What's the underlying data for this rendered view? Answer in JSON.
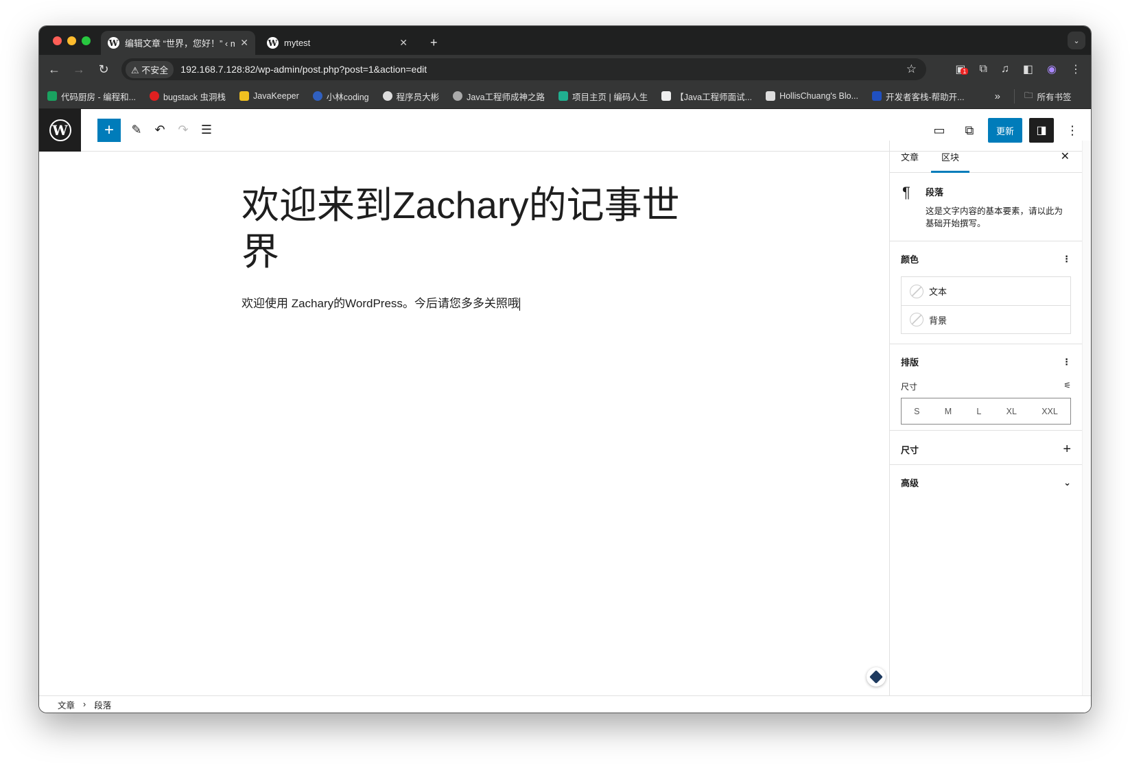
{
  "browser": {
    "tabs": [
      {
        "title": "编辑文章 “世界，您好！” ‹ my",
        "active": true
      },
      {
        "title": "mytest",
        "active": false
      }
    ],
    "new_tab": "+",
    "security": "不安全",
    "url": "192.168.7.128:82/wp-admin/post.php?post=1&action=edit",
    "ext_badge": "1",
    "bookmarks": [
      {
        "label": "代码厨房 - 编程和...",
        "color": "#1aa260"
      },
      {
        "label": "bugstack 虫洞栈",
        "color": "#e02020"
      },
      {
        "label": "JavaKeeper",
        "color": "#f0c020"
      },
      {
        "label": "小林coding",
        "color": "#3060c0"
      },
      {
        "label": "程序员大彬",
        "color": "#ddd"
      },
      {
        "label": "Java工程师成神之路",
        "color": "#aaa"
      },
      {
        "label": "项目主页 | 编码人生",
        "color": "#20b090"
      },
      {
        "label": "【Java工程师面试...",
        "color": "#eee"
      },
      {
        "label": "HollisChuang's Blo...",
        "color": "#ddd"
      },
      {
        "label": "开发者客栈-帮助开...",
        "color": "#2050c0"
      }
    ],
    "more": "»",
    "all_bookmarks": "所有书签"
  },
  "editor": {
    "update_label": "更新",
    "post_title": "欢迎来到Zachary的记事世界",
    "paragraph": "欢迎使用 Zachary的WordPress。今后请您多多关照哦"
  },
  "sidebar": {
    "tabs": [
      "文章",
      "区块"
    ],
    "block_name": "段落",
    "block_desc": "这是文字内容的基本要素，请以此为基础开始撰写。",
    "color_heading": "颜色",
    "color_items": [
      "文本",
      "背景"
    ],
    "typography_heading": "排版",
    "size_label": "尺寸",
    "sizes": [
      "S",
      "M",
      "L",
      "XL",
      "XXL"
    ],
    "dimensions_heading": "尺寸",
    "advanced_heading": "高级"
  },
  "breadcrumb": [
    "文章",
    "段落"
  ]
}
